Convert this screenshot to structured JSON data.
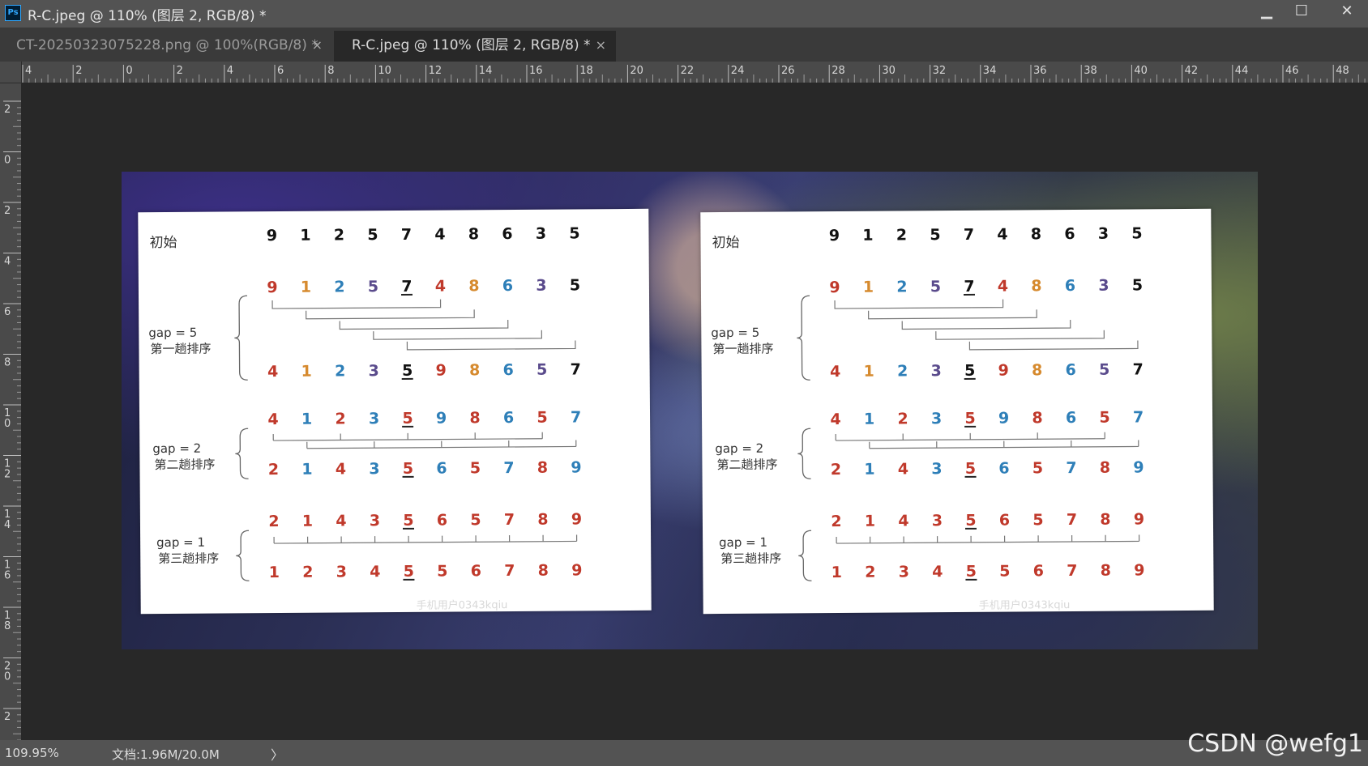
{
  "window": {
    "app_icon_text": "Ps",
    "title": "R-C.jpeg @ 110% (图层 2, RGB/8) *",
    "minimize_glyph": "▁",
    "maximize_glyph": "☐",
    "close_glyph": "✕"
  },
  "tabs": [
    {
      "label": "CT-20250323075228.png @ 100%(RGB/8) *",
      "close_glyph": "×",
      "active": false
    },
    {
      "label": "R-C.jpeg @ 110% (图层 2, RGB/8) *",
      "close_glyph": "×",
      "active": true
    }
  ],
  "rulers": {
    "top_labels": [
      "4",
      "2",
      "0",
      "2",
      "4",
      "6",
      "8",
      "10",
      "12",
      "14",
      "16",
      "18",
      "20",
      "22",
      "24",
      "26",
      "28",
      "30",
      "32",
      "34",
      "36",
      "38",
      "40",
      "42",
      "44",
      "46",
      "48"
    ],
    "left_labels": [
      "2",
      "0",
      "2",
      "4",
      "6",
      "8",
      "10",
      "12",
      "14",
      "16",
      "18",
      "20",
      "2"
    ]
  },
  "status": {
    "zoom": "109.95%",
    "doc": "文档:1.96M/20.0M",
    "arrow": "〉"
  },
  "watermark": "CSDN @wefg1",
  "panels": [
    {
      "row_labels": {
        "initial": "初始",
        "gap5": "gap = 5",
        "pass1": "第一趟排序",
        "gap2": "gap = 2",
        "pass2": "第二趟排序",
        "gap1": "gap = 1",
        "pass3": "第三趟排序"
      },
      "faint_mark": "手机用户0343kqiu",
      "rows": [
        {
          "name": "initial",
          "values": [
            9,
            1,
            2,
            5,
            7,
            4,
            8,
            6,
            3,
            5
          ],
          "colors": [
            "#111",
            "#111",
            "#111",
            "#111",
            "#111",
            "#111",
            "#111",
            "#111",
            "#111",
            "#111"
          ]
        },
        {
          "name": "gap5-before",
          "values": [
            9,
            1,
            2,
            5,
            7,
            4,
            8,
            6,
            3,
            5
          ],
          "colors": [
            "#c0392b",
            "#d68a2e",
            "#2e7fb8",
            "#5a4b8c",
            "#111",
            "#c0392b",
            "#d68a2e",
            "#2e7fb8",
            "#5a4b8c",
            "#111"
          ]
        },
        {
          "name": "gap5-after",
          "values": [
            4,
            1,
            2,
            3,
            5,
            9,
            8,
            6,
            5,
            7
          ],
          "colors": [
            "#c0392b",
            "#d68a2e",
            "#2e7fb8",
            "#5a4b8c",
            "#111",
            "#c0392b",
            "#d68a2e",
            "#2e7fb8",
            "#5a4b8c",
            "#111"
          ]
        },
        {
          "name": "gap2-before",
          "values": [
            4,
            1,
            2,
            3,
            5,
            9,
            8,
            6,
            5,
            7
          ],
          "colors": [
            "#c0392b",
            "#2e7fb8",
            "#c0392b",
            "#2e7fb8",
            "#c0392b",
            "#2e7fb8",
            "#c0392b",
            "#2e7fb8",
            "#c0392b",
            "#2e7fb8"
          ]
        },
        {
          "name": "gap2-after",
          "values": [
            2,
            1,
            4,
            3,
            5,
            6,
            5,
            7,
            8,
            9
          ],
          "colors": [
            "#c0392b",
            "#2e7fb8",
            "#c0392b",
            "#2e7fb8",
            "#c0392b",
            "#2e7fb8",
            "#c0392b",
            "#2e7fb8",
            "#c0392b",
            "#2e7fb8"
          ]
        },
        {
          "name": "gap1-before",
          "values": [
            2,
            1,
            4,
            3,
            5,
            6,
            5,
            7,
            8,
            9
          ],
          "colors": [
            "#c0392b",
            "#c0392b",
            "#c0392b",
            "#c0392b",
            "#c0392b",
            "#c0392b",
            "#c0392b",
            "#c0392b",
            "#c0392b",
            "#c0392b"
          ]
        },
        {
          "name": "gap1-after",
          "values": [
            1,
            2,
            3,
            4,
            5,
            5,
            6,
            7,
            8,
            9
          ],
          "colors": [
            "#c0392b",
            "#c0392b",
            "#c0392b",
            "#c0392b",
            "#c0392b",
            "#c0392b",
            "#c0392b",
            "#c0392b",
            "#c0392b",
            "#c0392b"
          ]
        }
      ],
      "underlined_index": 4
    },
    {
      "row_labels": {
        "initial": "初始",
        "gap5": "gap = 5",
        "pass1": "第一趟排序",
        "gap2": "gap = 2",
        "pass2": "第二趟排序",
        "gap1": "gap = 1",
        "pass3": "第三趟排序"
      },
      "faint_mark": "手机用户0343kqiu",
      "rows": [
        {
          "name": "initial",
          "values": [
            9,
            1,
            2,
            5,
            7,
            4,
            8,
            6,
            3,
            5
          ],
          "colors": [
            "#111",
            "#111",
            "#111",
            "#111",
            "#111",
            "#111",
            "#111",
            "#111",
            "#111",
            "#111"
          ]
        },
        {
          "name": "gap5-before",
          "values": [
            9,
            1,
            2,
            5,
            7,
            4,
            8,
            6,
            3,
            5
          ],
          "colors": [
            "#c0392b",
            "#d68a2e",
            "#2e7fb8",
            "#5a4b8c",
            "#111",
            "#c0392b",
            "#d68a2e",
            "#2e7fb8",
            "#5a4b8c",
            "#111"
          ]
        },
        {
          "name": "gap5-after",
          "values": [
            4,
            1,
            2,
            3,
            5,
            9,
            8,
            6,
            5,
            7
          ],
          "colors": [
            "#c0392b",
            "#d68a2e",
            "#2e7fb8",
            "#5a4b8c",
            "#111",
            "#c0392b",
            "#d68a2e",
            "#2e7fb8",
            "#5a4b8c",
            "#111"
          ]
        },
        {
          "name": "gap2-before",
          "values": [
            4,
            1,
            2,
            3,
            5,
            9,
            8,
            6,
            5,
            7
          ],
          "colors": [
            "#c0392b",
            "#2e7fb8",
            "#c0392b",
            "#2e7fb8",
            "#c0392b",
            "#2e7fb8",
            "#c0392b",
            "#2e7fb8",
            "#c0392b",
            "#2e7fb8"
          ]
        },
        {
          "name": "gap2-after",
          "values": [
            2,
            1,
            4,
            3,
            5,
            6,
            5,
            7,
            8,
            9
          ],
          "colors": [
            "#c0392b",
            "#2e7fb8",
            "#c0392b",
            "#2e7fb8",
            "#c0392b",
            "#2e7fb8",
            "#c0392b",
            "#2e7fb8",
            "#c0392b",
            "#2e7fb8"
          ]
        },
        {
          "name": "gap1-before",
          "values": [
            2,
            1,
            4,
            3,
            5,
            6,
            5,
            7,
            8,
            9
          ],
          "colors": [
            "#c0392b",
            "#c0392b",
            "#c0392b",
            "#c0392b",
            "#c0392b",
            "#c0392b",
            "#c0392b",
            "#c0392b",
            "#c0392b",
            "#c0392b"
          ]
        },
        {
          "name": "gap1-after",
          "values": [
            1,
            2,
            3,
            4,
            5,
            5,
            6,
            7,
            8,
            9
          ],
          "colors": [
            "#c0392b",
            "#c0392b",
            "#c0392b",
            "#c0392b",
            "#c0392b",
            "#c0392b",
            "#c0392b",
            "#c0392b",
            "#c0392b",
            "#c0392b"
          ]
        }
      ],
      "underlined_index": 4
    }
  ]
}
